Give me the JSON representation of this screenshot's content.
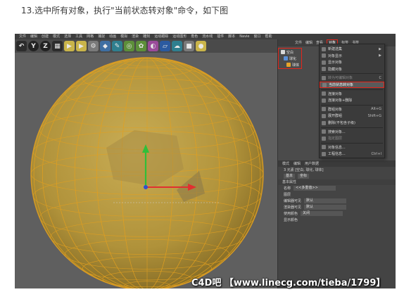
{
  "caption": "13.选中所有对象，执行\"当前状态转对象\"命令，如下图",
  "menubar": [
    "文件",
    "编辑",
    "创建",
    "模式",
    "选择",
    "工具",
    "网格",
    "捕捉",
    "动画",
    "模拟",
    "渲染",
    "雕刻",
    "运动跟踪",
    "运动图形",
    "角色",
    "流水线",
    "插件",
    "脚本",
    "Navie",
    "窗口",
    "帮助"
  ],
  "toolbar": {
    "buttons": [
      {
        "name": "undo-icon",
        "glyph": "↶"
      },
      {
        "name": "scale-icon",
        "glyph": "Y"
      },
      {
        "name": "rotate-icon",
        "glyph": "Z"
      },
      {
        "name": "coordinate-icon",
        "glyph": "▦"
      },
      {
        "name": "render-view-icon",
        "glyph": "▶"
      },
      {
        "name": "render-picture-icon",
        "glyph": "▶"
      },
      {
        "name": "render-settings-icon",
        "glyph": "⚙"
      },
      {
        "name": "cube-icon",
        "glyph": "◆"
      },
      {
        "name": "pen-icon",
        "glyph": "✎"
      },
      {
        "name": "subdivision-icon",
        "glyph": "◎"
      },
      {
        "name": "array-icon",
        "glyph": "✿"
      },
      {
        "name": "deformer-icon",
        "glyph": "◐"
      },
      {
        "name": "floor-icon",
        "glyph": "▱"
      },
      {
        "name": "sky-icon",
        "glyph": "☁"
      },
      {
        "name": "camera-icon",
        "glyph": "■"
      },
      {
        "name": "light-icon",
        "glyph": "●"
      }
    ]
  },
  "object_manager": {
    "tabs": [
      "文件",
      "编辑",
      "查看",
      "对象",
      "标签",
      "书签"
    ],
    "active_tab": "对象",
    "objects": [
      {
        "label": "空白",
        "color": "#d8d8d8"
      },
      {
        "label": "球化",
        "color": "#5b8fd6"
      },
      {
        "label": "球体",
        "color": "#e6a42a"
      }
    ]
  },
  "context_menu": {
    "items": [
      {
        "label": "新建选集",
        "shortcut": "▶",
        "state": "normal"
      },
      {
        "label": "对象显示",
        "shortcut": "▶",
        "state": "normal"
      },
      {
        "label": "显示对象",
        "shortcut": "",
        "state": "normal"
      },
      {
        "label": "隐藏对象",
        "shortcut": "",
        "state": "normal"
      },
      {
        "label": "转为可编辑对象",
        "shortcut": "C",
        "state": "disabled"
      },
      {
        "label": "当前状态转对象",
        "shortcut": "",
        "state": "highlight"
      },
      {
        "label": "连接对象",
        "shortcut": "",
        "state": "normal"
      },
      {
        "label": "连接对象+删除",
        "shortcut": "",
        "state": "normal"
      },
      {
        "label": "群组对象",
        "shortcut": "Alt+G",
        "state": "normal"
      },
      {
        "label": "展开群组",
        "shortcut": "Shift+G",
        "state": "normal"
      },
      {
        "label": "删除(不包含子级)",
        "shortcut": "",
        "state": "normal"
      },
      {
        "label": "搜索对象...",
        "shortcut": "",
        "state": "normal"
      },
      {
        "label": "指定图层",
        "shortcut": "",
        "state": "disabled"
      },
      {
        "label": "对象信息...",
        "shortcut": "",
        "state": "normal"
      },
      {
        "label": "工程信息...",
        "shortcut": "Ctrl+I",
        "state": "normal"
      }
    ]
  },
  "attributes": {
    "tabs": [
      "模式",
      "编辑",
      "用户数据"
    ],
    "title": "3 元素 [空白, 球化, 球体]",
    "subtabs": [
      "基本",
      "坐标"
    ],
    "section": "基本属性",
    "fields": [
      {
        "label": "名称",
        "value": "<<多重值>>"
      },
      {
        "label": "图层",
        "value": ""
      },
      {
        "label": "编辑器可见",
        "value": "默认"
      },
      {
        "label": "渲染器可见",
        "value": "默认"
      },
      {
        "label": "使用颜色",
        "value": "关闭"
      },
      {
        "label": "显示颜色",
        "value": ""
      }
    ]
  },
  "watermark": "C4D吧 【www.linecg.com/tieba/1799】",
  "colors": {
    "highlight_red": "#e3261c",
    "sphere_fill": "#b89a3e",
    "wire_orange": "#e2a020",
    "viewport_bg": "#5f5f5f"
  }
}
